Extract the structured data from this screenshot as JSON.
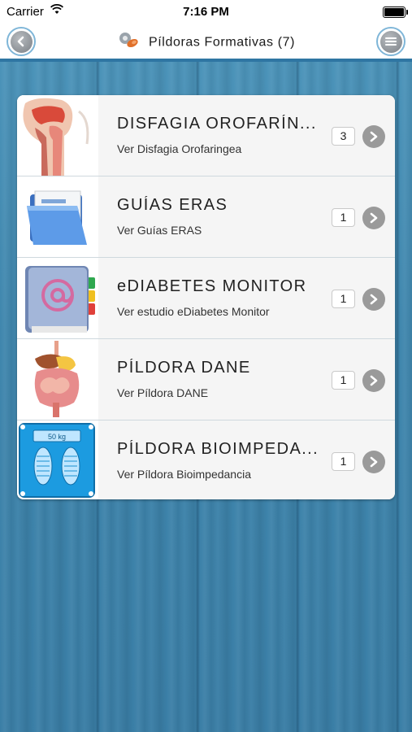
{
  "status": {
    "carrier": "Carrier",
    "time": "7:16 PM"
  },
  "nav": {
    "title": "Píldoras Formativas (7)"
  },
  "items": [
    {
      "title": "DISFAGIA OROFARÍN...",
      "subtitle": "Ver Disfagia Orofaringea",
      "count": "3",
      "icon": "throat-anatomy-icon"
    },
    {
      "title": "GUÍAS ERAS",
      "subtitle": "Ver Guías ERAS",
      "count": "1",
      "icon": "folder-documents-icon"
    },
    {
      "title": "eDIABETES MONITOR",
      "subtitle": "Ver estudio eDiabetes Monitor",
      "count": "1",
      "icon": "address-book-icon"
    },
    {
      "title": "PÍLDORA DANE",
      "subtitle": "Ver Píldora DANE",
      "count": "1",
      "icon": "digestive-system-icon"
    },
    {
      "title": "PÍLDORA BIOIMPEDA...",
      "subtitle": "Ver Píldora Bioimpedancia",
      "count": "1",
      "icon": "scale-icon",
      "scale_label": "50 kg"
    }
  ]
}
